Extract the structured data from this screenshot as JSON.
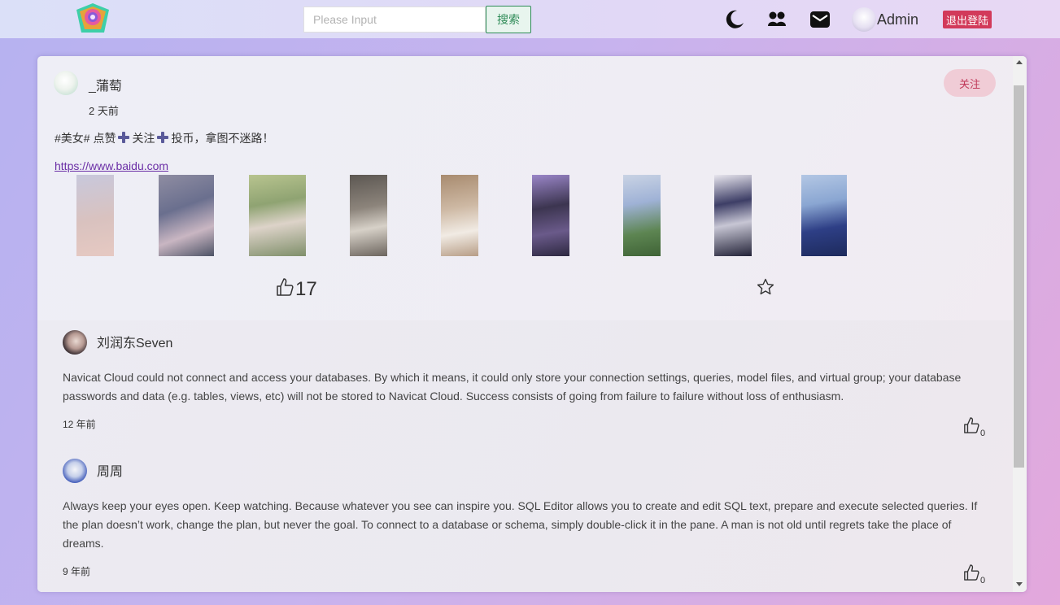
{
  "header": {
    "logo_icon": "app-logo-icon",
    "search": {
      "placeholder": "Please Input",
      "value": "",
      "button_label": "搜索"
    },
    "icons": [
      "moon-icon",
      "users-icon",
      "mail-icon"
    ],
    "user": {
      "name": "Admin",
      "avatar": "avatar"
    },
    "logout_label": "退出登陆"
  },
  "post": {
    "author": "_蒲萄",
    "time": "2 天前",
    "follow_label": "关注",
    "text_before": "#美女# 点赞",
    "text_mid": "关注",
    "text_after": "投币，拿图不迷路！",
    "link": "https://www.baidu.com",
    "images": [
      {
        "icon": "photo-1",
        "colors": [
          "#d6c3c0",
          "#9aa8c8"
        ]
      },
      {
        "icon": "photo-2",
        "colors": [
          "#5a5f78",
          "#c6b7c5"
        ]
      },
      {
        "icon": "photo-3",
        "colors": [
          "#a7b38a",
          "#e0d4c7"
        ]
      },
      {
        "icon": "photo-4",
        "colors": [
          "#6c6560",
          "#cfc9c0"
        ]
      },
      {
        "icon": "photo-5",
        "colors": [
          "#b49a80",
          "#efe7df"
        ]
      },
      {
        "icon": "photo-6",
        "colors": [
          "#3c3550",
          "#8b6fc0"
        ]
      },
      {
        "icon": "photo-7",
        "colors": [
          "#4f7a4a",
          "#b5c6e3"
        ]
      },
      {
        "icon": "photo-8",
        "colors": [
          "#e4e2ea",
          "#2e2f4e"
        ]
      },
      {
        "icon": "photo-9",
        "colors": [
          "#9fb8da",
          "#2b3f86"
        ]
      }
    ],
    "likes": "17"
  },
  "comments": [
    {
      "name": "刘润东Seven",
      "text": "Navicat Cloud could not connect and access your databases. By which it means, it could only store your connection settings, queries, model files, and virtual group; your database passwords and data (e.g. tables, views, etc) will not be stored to Navicat Cloud. Success consists of going from failure to failure without loss of enthusiasm.",
      "time": "12 年前",
      "likes": "0"
    },
    {
      "name": "周周",
      "text": "Always keep your eyes open. Keep watching. Because whatever you see can inspire you. SQL Editor allows you to create and edit SQL text, prepare and execute selected queries. If the plan doesn’t work, change the plan, but never the goal. To connect to a database or schema, simply double-click it in the pane. A man is not old until regrets take the place of dreams.",
      "time": "9 年前",
      "likes": "0"
    }
  ],
  "colors": {
    "accent_green": "#2e8b57",
    "logout_red": "#d23a5a",
    "follow_pink": "#f0ccd6",
    "link_purple": "#6b2fa6"
  }
}
